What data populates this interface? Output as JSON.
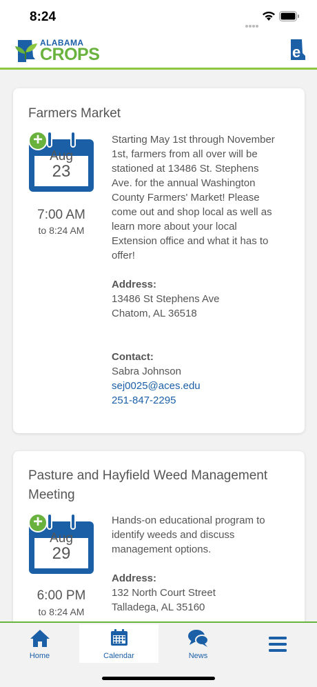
{
  "status_bar": {
    "time": "8:24"
  },
  "header": {
    "logo_top": "ALABAMA",
    "logo_bottom": "CROPS"
  },
  "events": [
    {
      "title": "Farmers Market",
      "month": "Aug",
      "day": "23",
      "time_start": "7:00 AM",
      "time_end": "to 8:24 AM",
      "description": "Starting May 1st through November 1st, farmers from all over will be stationed at 13486 St. Stephens Ave. for the annual Washington County Farmers' Market! Please come out and shop local as well as learn more about your local Extension office and what it has to offer!",
      "address_label": "Address:",
      "address_line1": "13486 St Stephens Ave",
      "address_line2": "Chatom, AL 36518",
      "contact_label": "Contact:",
      "contact_name": "Sabra Johnson",
      "contact_email": "sej0025@aces.edu",
      "contact_phone": "251-847-2295"
    },
    {
      "title": "Pasture and Hayfield Weed Management Meeting",
      "month": "Aug",
      "day": "29",
      "time_start": "6:00 PM",
      "time_end": "to 8:24 AM",
      "description": "Hands-on educational program to identify weeds and discuss management options.",
      "address_label": "Address:",
      "address_line1": "132 North Court Street",
      "address_line2": "Talladega, AL 35160"
    }
  ],
  "tabs": [
    {
      "label": "Home",
      "icon": "home-icon"
    },
    {
      "label": "Calendar",
      "icon": "calendar-icon"
    },
    {
      "label": "News",
      "icon": "news-icon"
    },
    {
      "label": "",
      "icon": "menu-icon"
    }
  ],
  "colors": {
    "brand_blue": "#1b5fa6",
    "brand_green": "#6ab23e",
    "divider_green": "#8dc63f"
  }
}
